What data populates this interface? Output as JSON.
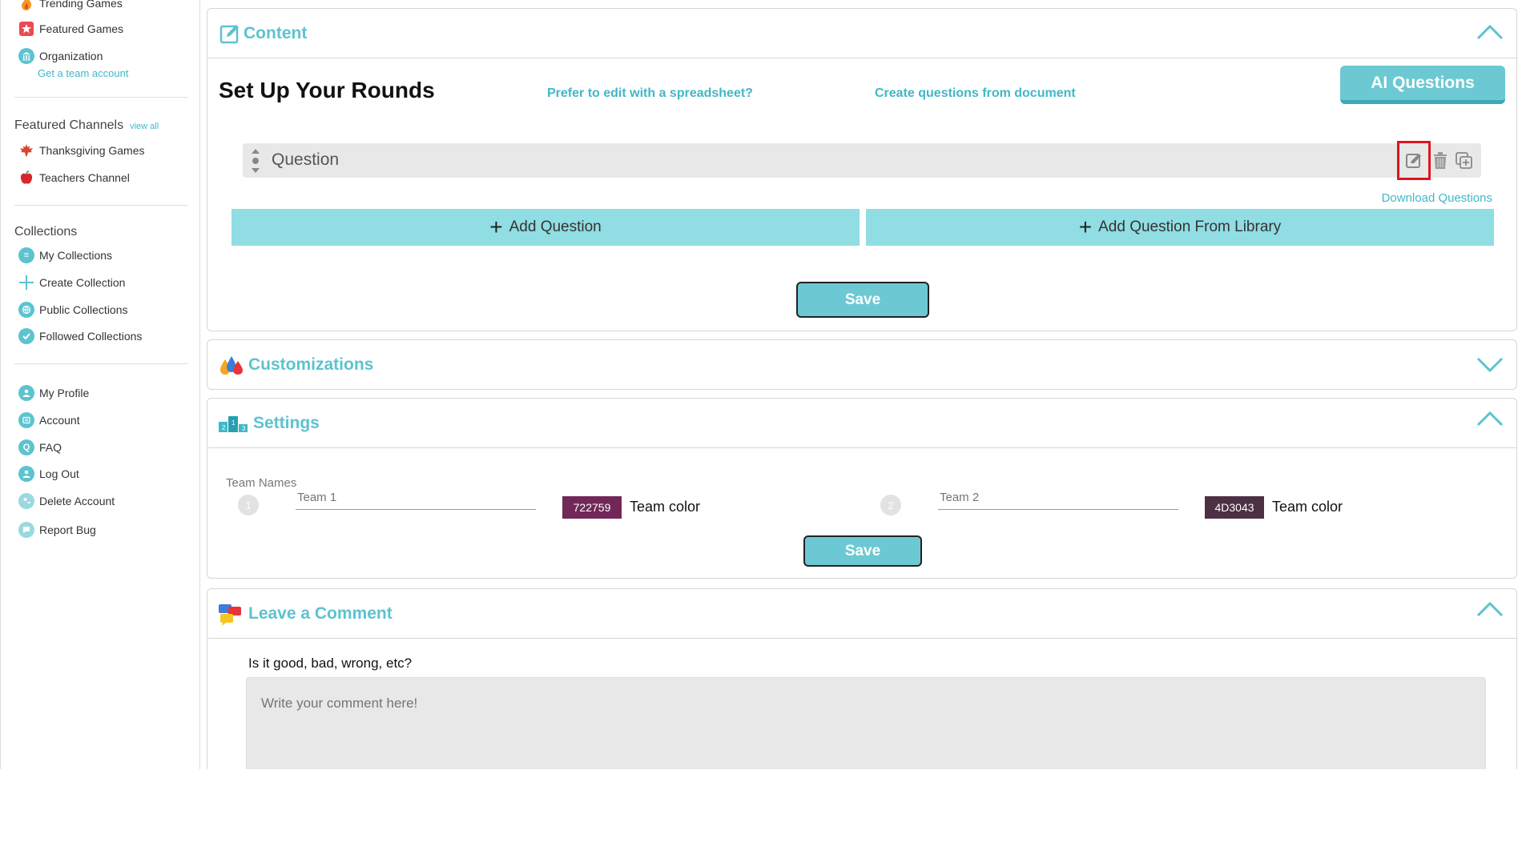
{
  "sidebar": {
    "items_top": [
      {
        "label": "Trending Games",
        "icon": "flame-icon"
      },
      {
        "label": "Featured Games",
        "icon": "star-icon"
      },
      {
        "label": "Organization",
        "icon": "building-icon"
      }
    ],
    "team_account_link": "Get a team account",
    "featured_channels": {
      "heading": "Featured Channels",
      "view_all": "view all",
      "items": [
        {
          "label": "Thanksgiving Games",
          "icon": "maple-leaf-icon"
        },
        {
          "label": "Teachers Channel",
          "icon": "apple-icon"
        }
      ]
    },
    "collections": {
      "heading": "Collections",
      "items": [
        {
          "label": "My Collections",
          "icon": "list-icon"
        },
        {
          "label": "Create Collection",
          "icon": "plus-icon"
        },
        {
          "label": "Public Collections",
          "icon": "globe-icon"
        },
        {
          "label": "Followed Collections",
          "icon": "check-icon"
        }
      ]
    },
    "account_items": [
      {
        "label": "My Profile",
        "icon": "user-icon"
      },
      {
        "label": "Account",
        "icon": "account-icon"
      },
      {
        "label": "FAQ",
        "icon": "faq-icon"
      },
      {
        "label": "Log Out",
        "icon": "logout-icon"
      },
      {
        "label": "Delete Account",
        "icon": "delete-account-icon"
      },
      {
        "label": "Report Bug",
        "icon": "bug-icon"
      }
    ]
  },
  "content": {
    "title": "Content",
    "heading": "Set Up Your Rounds",
    "spreadsheet_link": "Prefer to edit with a spreadsheet?",
    "document_link": "Create questions from document",
    "ai_button": "AI Questions",
    "question_label": "Question",
    "download_link": "Download Questions",
    "add_question": "Add Question",
    "add_from_library": "Add Question From Library",
    "save": "Save"
  },
  "customizations": {
    "title": "Customizations"
  },
  "settings": {
    "title": "Settings",
    "team_names_label": "Team Names",
    "teams": [
      {
        "number": "1",
        "placeholder": "Team 1",
        "color_hex": "722759",
        "color_label": "Team color",
        "color": "#722759"
      },
      {
        "number": "2",
        "placeholder": "Team 2",
        "color_hex": "4D3043",
        "color_label": "Team color",
        "color": "#4D3043"
      }
    ],
    "save": "Save"
  },
  "comment": {
    "title": "Leave a Comment",
    "prompt": "Is it good, bad, wrong, etc?",
    "placeholder": "Write your comment here!"
  },
  "colors": {
    "accent": "#5cc3cf",
    "highlight": "#e0141e"
  }
}
